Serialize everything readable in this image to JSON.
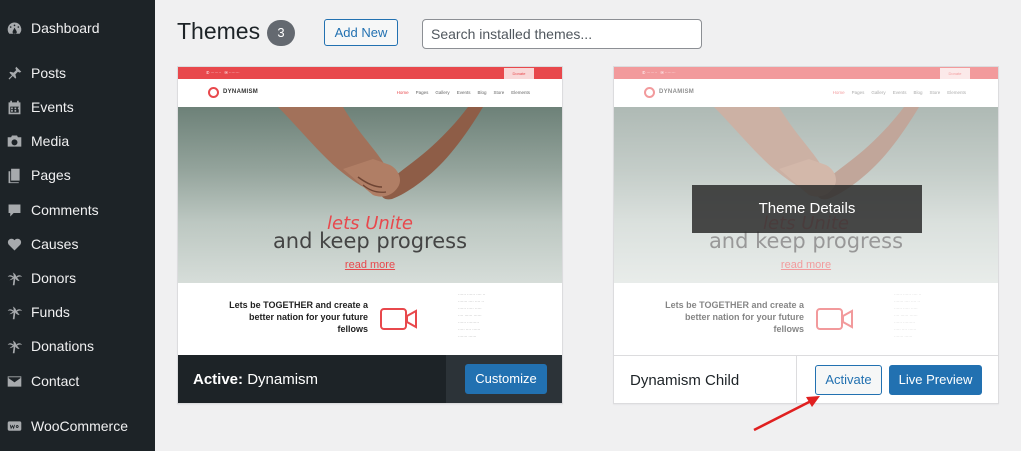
{
  "sidebar": {
    "items": [
      {
        "label": "Dashboard",
        "icon": "dashboard-icon"
      },
      {
        "label": "Posts",
        "icon": "pushpin-icon"
      },
      {
        "label": "Events",
        "icon": "calendar-icon"
      },
      {
        "label": "Media",
        "icon": "media-icon"
      },
      {
        "label": "Pages",
        "icon": "pages-icon"
      },
      {
        "label": "Comments",
        "icon": "comment-icon"
      },
      {
        "label": "Causes",
        "icon": "heart-hand-icon"
      },
      {
        "label": "Donors",
        "icon": "palm-tree-icon"
      },
      {
        "label": "Funds",
        "icon": "palm-tree-icon"
      },
      {
        "label": "Donations",
        "icon": "palm-tree-icon"
      },
      {
        "label": "Contact",
        "icon": "envelope-icon"
      },
      {
        "label": "WooCommerce",
        "icon": "woocommerce-icon"
      }
    ]
  },
  "header": {
    "title": "Themes",
    "count": "3",
    "add_new_label": "Add New",
    "search_placeholder": "Search installed themes..."
  },
  "preview": {
    "logo_text": "DYNAMISM",
    "nav_links": [
      "Home",
      "Pages",
      "Gallery",
      "Events",
      "Blog",
      "Store",
      "Elements"
    ],
    "topbar_button": "Donate",
    "hero_sub": "lets Unite",
    "hero_main": "and keep progress",
    "hero_link": "read more",
    "together_text": "Lets be TOGETHER and create a better nation for your future fellows"
  },
  "themes": [
    {
      "active_prefix": "Active:",
      "name": "Dynamism",
      "customize_label": "Customize"
    },
    {
      "name": "Dynamism Child",
      "details_label": "Theme Details",
      "activate_label": "Activate",
      "live_preview_label": "Live Preview"
    }
  ],
  "colors": {
    "sidebar_bg": "#1d2327",
    "primary_blue": "#2271b1",
    "brand_red": "#e8484c",
    "annotation_arrow": "#e02020"
  }
}
